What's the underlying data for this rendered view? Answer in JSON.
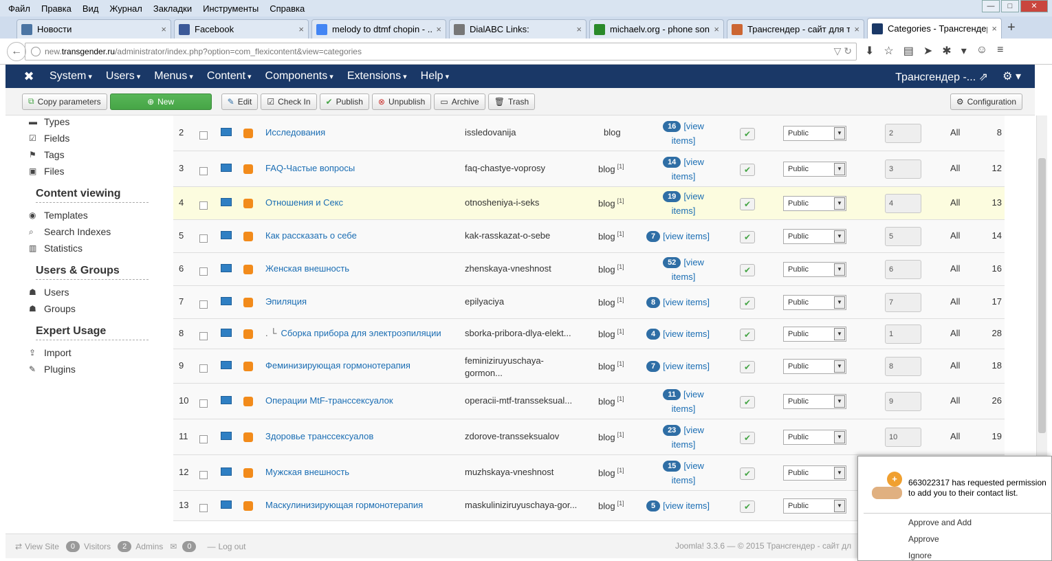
{
  "browser": {
    "menu": [
      "Файл",
      "Правка",
      "Вид",
      "Журнал",
      "Закладки",
      "Инструменты",
      "Справка"
    ],
    "window_controls": {
      "minimize": "—",
      "maximize": "□",
      "close": "✕"
    },
    "tabs": [
      {
        "title": "Новости",
        "icon": "vk-icon",
        "color": "#4c75a3"
      },
      {
        "title": "Facebook",
        "icon": "facebook-icon",
        "color": "#3b5998"
      },
      {
        "title": "melody to dtmf chopin - ...",
        "icon": "google-icon",
        "color": "#4285f4"
      },
      {
        "title": "DialABC Links:",
        "icon": "dialabc-icon",
        "color": "#777777"
      },
      {
        "title": "michaelv.org - phone songs",
        "icon": "michaelv-icon",
        "color": "#2a8a2a"
      },
      {
        "title": "Трансгендер - сайт для т...",
        "icon": "transgender-icon",
        "color": "#cc6633"
      },
      {
        "title": "Categories - Трансгендер ...",
        "icon": "joomla-icon",
        "color": "#1a3867"
      }
    ],
    "url_host_prefix": "new.",
    "url_host": "transgender.ru",
    "url_path": "/administrator/index.php?option=com_flexicontent&view=categories"
  },
  "joomla": {
    "menu": [
      "System",
      "Users",
      "Menus",
      "Content",
      "Components",
      "Extensions",
      "Help"
    ],
    "site_name": "Трансгендер -...",
    "toolbar": {
      "copy": "Copy parameters",
      "new": "New",
      "edit": "Edit",
      "checkin": "Check In",
      "publish": "Publish",
      "unpublish": "Unpublish",
      "archive": "Archive",
      "trash": "Trash",
      "config": "Configuration"
    }
  },
  "sidebar": {
    "top_items": [
      {
        "label": "Types",
        "icon": "types-icon"
      },
      {
        "label": "Fields",
        "icon": "fields-icon"
      },
      {
        "label": "Tags",
        "icon": "tags-icon"
      },
      {
        "label": "Files",
        "icon": "files-icon"
      }
    ],
    "sections": [
      {
        "heading": "Content viewing",
        "items": [
          {
            "label": "Templates",
            "icon": "eye-icon"
          },
          {
            "label": "Search Indexes",
            "icon": "search-icon"
          },
          {
            "label": "Statistics",
            "icon": "chart-icon"
          }
        ]
      },
      {
        "heading": "Users & Groups",
        "items": [
          {
            "label": "Users",
            "icon": "user-icon"
          },
          {
            "label": "Groups",
            "icon": "users-icon"
          }
        ]
      },
      {
        "heading": "Expert Usage",
        "items": [
          {
            "label": "Import",
            "icon": "upload-icon"
          },
          {
            "label": "Plugins",
            "icon": "plug-icon"
          }
        ]
      }
    ]
  },
  "categories": [
    {
      "num": "2",
      "title": "Исследования",
      "prefix": "",
      "alias": "issledovanija",
      "template": "blog",
      "template_sup": "",
      "count": "16",
      "view_items": "[view items]",
      "access": "Public",
      "order": "2",
      "language": "All",
      "id": "8"
    },
    {
      "num": "3",
      "title": "FAQ-Частые вопросы",
      "prefix": "",
      "alias": "faq-chastye-voprosy",
      "template": "blog",
      "template_sup": "[1]",
      "count": "14",
      "view_items": "[view items]",
      "access": "Public",
      "order": "3",
      "language": "All",
      "id": "12"
    },
    {
      "num": "4",
      "title": "Отношения и Секс",
      "prefix": "",
      "alias": "otnosheniya-i-seks",
      "template": "blog",
      "template_sup": "[1]",
      "count": "19",
      "view_items": "[view items]",
      "access": "Public",
      "order": "4",
      "language": "All",
      "id": "13"
    },
    {
      "num": "5",
      "title": "Как рассказать о себе",
      "prefix": "",
      "alias": "kak-rasskazat-o-sebe",
      "template": "blog",
      "template_sup": "[1]",
      "count": "7",
      "view_items": "[view items]",
      "access": "Public",
      "order": "5",
      "language": "All",
      "id": "14"
    },
    {
      "num": "6",
      "title": "Женская внешность",
      "prefix": "",
      "alias": "zhenskaya-vneshnost",
      "template": "blog",
      "template_sup": "[1]",
      "count": "52",
      "view_items": "[view items]",
      "access": "Public",
      "order": "6",
      "language": "All",
      "id": "16"
    },
    {
      "num": "7",
      "title": "Эпиляция",
      "prefix": "",
      "alias": "epilyaciya",
      "template": "blog",
      "template_sup": "[1]",
      "count": "8",
      "view_items": "[view items]",
      "access": "Public",
      "order": "7",
      "language": "All",
      "id": "17"
    },
    {
      "num": "8",
      "title": "Сборка прибора для электроэпиляции",
      "prefix": ". └",
      "alias": "sborka-pribora-dlya-elekt...",
      "template": "blog",
      "template_sup": "[1]",
      "count": "4",
      "view_items": "[view items]",
      "access": "Public",
      "order": "1",
      "language": "All",
      "id": "28"
    },
    {
      "num": "9",
      "title": "Феминизирующая гормонотерапия",
      "prefix": "",
      "alias": "feminiziruyuschaya-gormon...",
      "template": "blog",
      "template_sup": "[1]",
      "count": "7",
      "view_items": "[view items]",
      "access": "Public",
      "order": "8",
      "language": "All",
      "id": "18"
    },
    {
      "num": "10",
      "title": "Операции MtF-транссексуалок",
      "prefix": "",
      "alias": "operacii-mtf-transseksual...",
      "template": "blog",
      "template_sup": "[1]",
      "count": "11",
      "view_items": "[view items]",
      "access": "Public",
      "order": "9",
      "language": "All",
      "id": "26"
    },
    {
      "num": "11",
      "title": "Здоровье транссексуалов",
      "prefix": "",
      "alias": "zdorove-transseksualov",
      "template": "blog",
      "template_sup": "[1]",
      "count": "23",
      "view_items": "[view items]",
      "access": "Public",
      "order": "10",
      "language": "All",
      "id": "19"
    },
    {
      "num": "12",
      "title": "Мужская внешность",
      "prefix": "",
      "alias": "muzhskaya-vneshnost",
      "template": "blog",
      "template_sup": "[1]",
      "count": "15",
      "view_items": "[view items]",
      "access": "Public",
      "order": "",
      "language": "",
      "id": ""
    },
    {
      "num": "13",
      "title": "Маскулинизирующая гормонотерапия",
      "prefix": "",
      "alias": "maskuliniziruyuschaya-gor...",
      "template": "blog",
      "template_sup": "[1]",
      "count": "5",
      "view_items": "[view items]",
      "access": "Public",
      "order": "",
      "language": "",
      "id": ""
    }
  ],
  "status": {
    "view_site": "View Site",
    "visitors_count": "0",
    "visitors": "Visitors",
    "admins_count": "2",
    "admins": "Admins",
    "messages_count": "0",
    "logout": "Log out",
    "version": "Joomla! 3.3.6  —  © 2015 Трансгендер - сайт дл"
  },
  "notification": {
    "message": "663022317 has requested permission to add you to their contact list.",
    "approve_add": "Approve and Add",
    "approve": "Approve",
    "ignore": "Ignore"
  }
}
